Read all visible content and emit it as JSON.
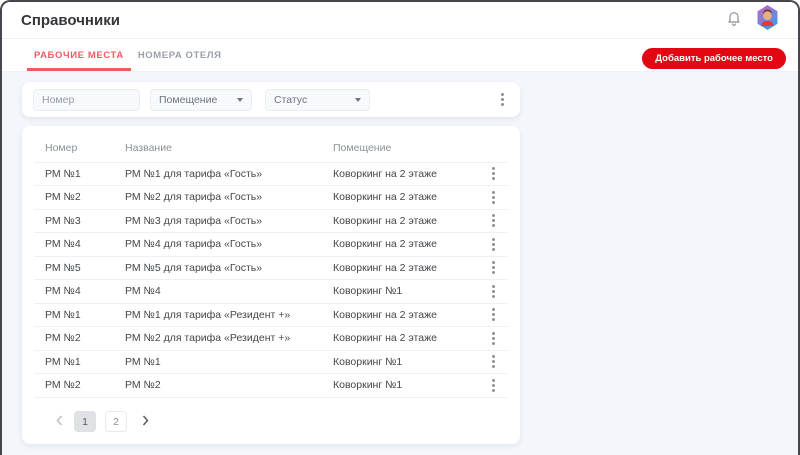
{
  "header": {
    "title": "Справочники"
  },
  "tabs": [
    {
      "label": "РАБОЧИЕ МЕСТА",
      "active": true
    },
    {
      "label": "НОМЕРА ОТЕЛЯ",
      "active": false
    }
  ],
  "toolbar": {
    "add_button_label": "Добавить рабочее место"
  },
  "filters": {
    "number_placeholder": "Номер",
    "room_label": "Помещение",
    "status_label": "Статус"
  },
  "table": {
    "columns": [
      "Номер",
      "Название",
      "Помещение"
    ],
    "rows": [
      [
        "РМ №1",
        "РМ №1 для тарифа «Гость»",
        "Коворкинг на 2 этаже"
      ],
      [
        "РМ №2",
        "РМ №2 для тарифа «Гость»",
        "Коворкинг на 2 этаже"
      ],
      [
        "РМ №3",
        "РМ №3 для тарифа «Гость»",
        "Коворкинг на 2 этаже"
      ],
      [
        "РМ №4",
        "РМ №4 для тарифа «Гость»",
        "Коворкинг на 2 этаже"
      ],
      [
        "РМ №5",
        "РМ №5 для тарифа «Гость»",
        "Коворкинг на 2 этаже"
      ],
      [
        "РМ №4",
        "РМ №4",
        "Коворкинг №1"
      ],
      [
        "РМ №1",
        "РМ №1 для тарифа «Резидент +»",
        "Коворкинг на 2 этаже"
      ],
      [
        "РМ №2",
        "РМ №2 для тарифа «Резидент +»",
        "Коворкинг на 2 этаже"
      ],
      [
        "РМ №1",
        "РМ №1",
        "Коворкинг №1"
      ],
      [
        "РМ №2",
        "РМ №2",
        "Коворкинг №1"
      ]
    ]
  },
  "pagination": {
    "pages": [
      {
        "label": "1",
        "active": true
      },
      {
        "label": "2",
        "active": false
      }
    ]
  },
  "icons": {
    "notifications": "bell",
    "avatar": "hexagon-user",
    "select_caret": "caret-down",
    "row_actions": "kebab-vertical",
    "filter_actions": "kebab-vertical",
    "pagination_prev": "chevron-left",
    "pagination_next": "chevron-right"
  },
  "colors": {
    "accent_red": "#e30613",
    "active_tab_red": "#f05a61",
    "page_background": "#f4f6fb",
    "frame_border": "#46464c"
  }
}
